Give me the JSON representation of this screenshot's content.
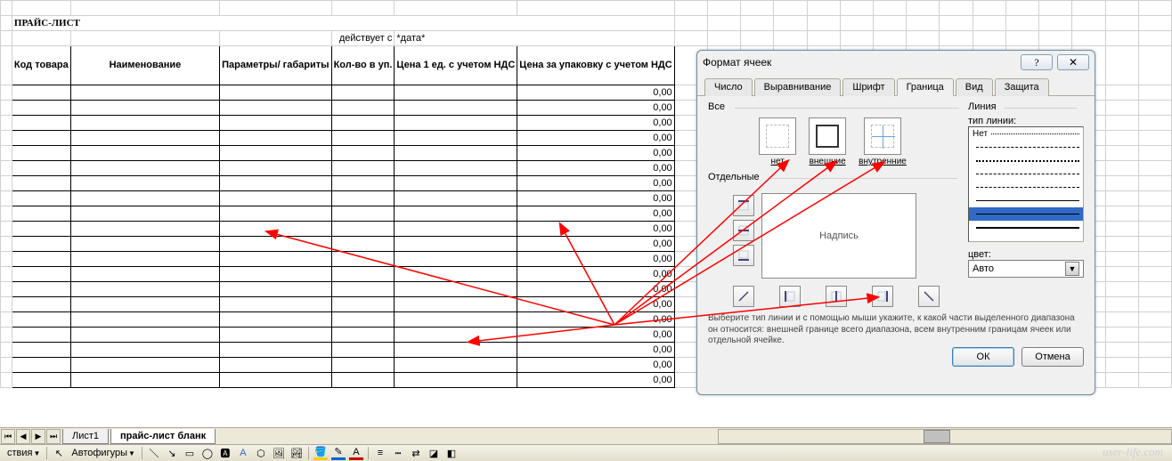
{
  "sheet": {
    "title": "ПРАЙС-ЛИСТ",
    "effective_label": "действует с",
    "effective_value": "*дата*",
    "headers": {
      "code": "Код товара",
      "name": "Наименование",
      "params": "Параметры/ габариты",
      "qty": "Кол-во в уп.",
      "price_unit": "Цена 1 ед. с учетом НДС",
      "price_pack": "Цена за упаковку с учетом НДС"
    },
    "default_price": "0,00",
    "row_count": 20
  },
  "tabs": {
    "sheet1": "Лист1",
    "blank": "прайс-лист бланк"
  },
  "toolbar": {
    "actions": "ствия",
    "autoshapes": "Автофигуры"
  },
  "dialog": {
    "title": "Формат ячеек",
    "tabs": {
      "number": "Число",
      "align": "Выравнивание",
      "font": "Шрифт",
      "border": "Граница",
      "fill": "Вид",
      "protect": "Защита"
    },
    "groups": {
      "all": "Все",
      "separate": "Отдельные",
      "line": "Линия"
    },
    "presets": {
      "none": "нет",
      "outer": "внешние",
      "inner": "внутренние"
    },
    "preview_label": "Надпись",
    "style_label": "тип линии:",
    "style_none": "Нет",
    "color_label": "цвет:",
    "color_value": "Авто",
    "hint": "Выберите тип линии и с помощью мыши укажите, к какой части выделенного диапазона он относится: внешней границе всего диапазона, всем внутренним границам ячеек или отдельной ячейке.",
    "ok": "ОК",
    "cancel": "Отмена"
  },
  "watermark": "user-life.com"
}
